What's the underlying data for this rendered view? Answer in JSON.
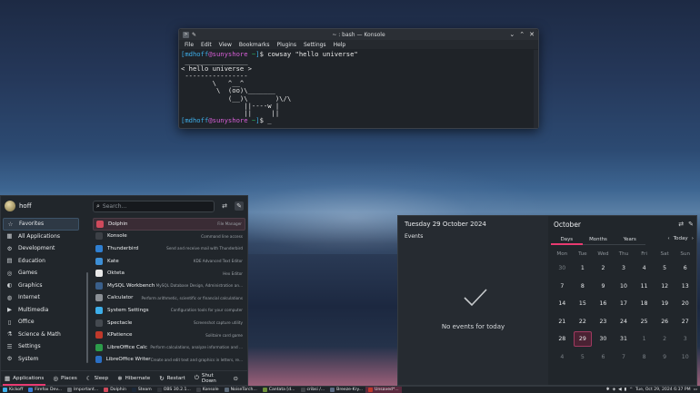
{
  "konsole": {
    "title": "~ : bash — Konsole",
    "menu": [
      "File",
      "Edit",
      "View",
      "Bookmarks",
      "Plugins",
      "Settings",
      "Help"
    ],
    "prompt_user": "mdhoff",
    "prompt_host": "sunyshore",
    "prompt_dir": "~",
    "command": "cowsay \"hello universe\"",
    "output": " ________________\n< hello universe >\n ----------------\n        \\   ^__^\n         \\  (oo)\\_______\n            (__)\\       )\\/\\\n                ||----w |\n                ||     ||"
  },
  "launcher": {
    "username": "hoff",
    "search_placeholder": "Search...",
    "categories": [
      {
        "label": "Favorites",
        "icon": "star-icon",
        "glyph": "☆"
      },
      {
        "label": "All Applications",
        "icon": "grid-icon",
        "glyph": "▦"
      },
      {
        "label": "Development",
        "icon": "code-icon",
        "glyph": "⚙"
      },
      {
        "label": "Education",
        "icon": "book-icon",
        "glyph": "▤"
      },
      {
        "label": "Games",
        "icon": "gamepad-icon",
        "glyph": "◎"
      },
      {
        "label": "Graphics",
        "icon": "palette-icon",
        "glyph": "◐"
      },
      {
        "label": "Internet",
        "icon": "globe-icon",
        "glyph": "◍"
      },
      {
        "label": "Multimedia",
        "icon": "media-icon",
        "glyph": "▶"
      },
      {
        "label": "Office",
        "icon": "document-icon",
        "glyph": "▯"
      },
      {
        "label": "Science & Math",
        "icon": "flask-icon",
        "glyph": "⚗"
      },
      {
        "label": "Settings",
        "icon": "sliders-icon",
        "glyph": "☰"
      },
      {
        "label": "System",
        "icon": "system-icon",
        "glyph": "⚙"
      }
    ],
    "apps": [
      {
        "name": "Dolphin",
        "desc": "File Manager",
        "icon": "dolphin-icon",
        "color": "#d04a5c"
      },
      {
        "name": "Konsole",
        "desc": "Command line access",
        "icon": "konsole-icon",
        "color": "#3c4046"
      },
      {
        "name": "Thunderbird",
        "desc": "Send and receive mail with Thunderbird",
        "icon": "thunderbird-icon",
        "color": "#2f7fd1"
      },
      {
        "name": "Kate",
        "desc": "KDE Advanced Text Editor",
        "icon": "kate-icon",
        "color": "#3d8fd6"
      },
      {
        "name": "Okteta",
        "desc": "Hex Editor",
        "icon": "okteta-icon",
        "color": "#e8e8e8"
      },
      {
        "name": "MySQL Workbench",
        "desc": "MySQL Database Design, Administration an...",
        "icon": "mysql-workbench-icon",
        "color": "#3a5f8a"
      },
      {
        "name": "Calculator",
        "desc": "Perform arithmetic, scientific or financial calculations",
        "icon": "calculator-icon",
        "color": "#8a8f95"
      },
      {
        "name": "System Settings",
        "desc": "Configuration tools for your computer",
        "icon": "system-settings-icon",
        "color": "#3daee9"
      },
      {
        "name": "Spectacle",
        "desc": "Screenshot capture utility",
        "icon": "spectacle-icon",
        "color": "#454a50"
      },
      {
        "name": "KPatience",
        "desc": "Solitaire card game",
        "icon": "kpatience-icon",
        "color": "#c0392b"
      },
      {
        "name": "LibreOffice Calc",
        "desc": "Perform calculations, analyze information and ...",
        "icon": "libreoffice-calc-icon",
        "color": "#2c9c4a"
      },
      {
        "name": "LibreOffice Writer",
        "desc": "Create and edit text and graphics in letters, re...",
        "icon": "libreoffice-writer-icon",
        "color": "#2a6fc4"
      }
    ],
    "footer": {
      "applications": "Applications",
      "places": "Places",
      "sleep": "Sleep",
      "hibernate": "Hibernate",
      "restart": "Restart",
      "shutdown": "Shut Down"
    }
  },
  "calendar": {
    "date_heading": "Tuesday 29 October 2024",
    "events_label": "Events",
    "no_events": "No events for today",
    "month": "October",
    "tabs": [
      "Days",
      "Months",
      "Years"
    ],
    "today_label": "Today",
    "weekdays": [
      "Mon",
      "Tue",
      "Wed",
      "Thu",
      "Fri",
      "Sat",
      "Sun"
    ],
    "days": [
      {
        "d": "30",
        "dim": true
      },
      {
        "d": "1"
      },
      {
        "d": "2"
      },
      {
        "d": "3"
      },
      {
        "d": "4"
      },
      {
        "d": "5"
      },
      {
        "d": "6"
      },
      {
        "d": "7"
      },
      {
        "d": "8"
      },
      {
        "d": "9"
      },
      {
        "d": "10"
      },
      {
        "d": "11"
      },
      {
        "d": "12"
      },
      {
        "d": "13"
      },
      {
        "d": "14"
      },
      {
        "d": "15"
      },
      {
        "d": "16"
      },
      {
        "d": "17"
      },
      {
        "d": "18"
      },
      {
        "d": "19"
      },
      {
        "d": "20"
      },
      {
        "d": "21"
      },
      {
        "d": "22"
      },
      {
        "d": "23"
      },
      {
        "d": "24"
      },
      {
        "d": "25"
      },
      {
        "d": "26"
      },
      {
        "d": "27"
      },
      {
        "d": "28"
      },
      {
        "d": "29",
        "today": true
      },
      {
        "d": "30"
      },
      {
        "d": "31"
      },
      {
        "d": "1",
        "dim": true
      },
      {
        "d": "2",
        "dim": true
      },
      {
        "d": "3",
        "dim": true
      },
      {
        "d": "4",
        "dim": true
      },
      {
        "d": "5",
        "dim": true
      },
      {
        "d": "6",
        "dim": true
      },
      {
        "d": "7",
        "dim": true
      },
      {
        "d": "8",
        "dim": true
      },
      {
        "d": "9",
        "dim": true
      },
      {
        "d": "10",
        "dim": true
      }
    ]
  },
  "taskbar": {
    "items": [
      {
        "label": "Kickoff",
        "icon": "kickoff-icon",
        "color": "#3daee9",
        "kick": true
      },
      {
        "label": "Firefox Dev...",
        "icon": "firefox-icon",
        "color": "#3a7bd5"
      },
      {
        "label": "Important...",
        "icon": "document-icon",
        "color": "#6a6f75"
      },
      {
        "label": "Dolphin",
        "icon": "dolphin-icon",
        "color": "#d04a5c"
      },
      {
        "label": "Steam",
        "icon": "steam-icon",
        "color": "#1b2838"
      },
      {
        "label": "OBS 30.2.1...",
        "icon": "obs-icon",
        "color": "#30343a"
      },
      {
        "label": "Konsole",
        "icon": "konsole-icon",
        "color": "#3c4046"
      },
      {
        "label": "NoiseTorch...",
        "icon": "noisetorch-icon",
        "color": "#5d6b7a"
      },
      {
        "label": "Cantata [d...",
        "icon": "cantata-icon",
        "color": "#6c8f3a"
      },
      {
        "label": "cribsi /...",
        "icon": "terminal-icon",
        "color": "#404448"
      },
      {
        "label": "Breeze-Kry...",
        "icon": "image-icon",
        "color": "#5a6a82"
      },
      {
        "label": "Unsaved*...",
        "icon": "editor-icon",
        "color": "#c0392b",
        "active": true
      }
    ],
    "clock": "Tue, Oct 29, 2024 6:37 PM"
  }
}
